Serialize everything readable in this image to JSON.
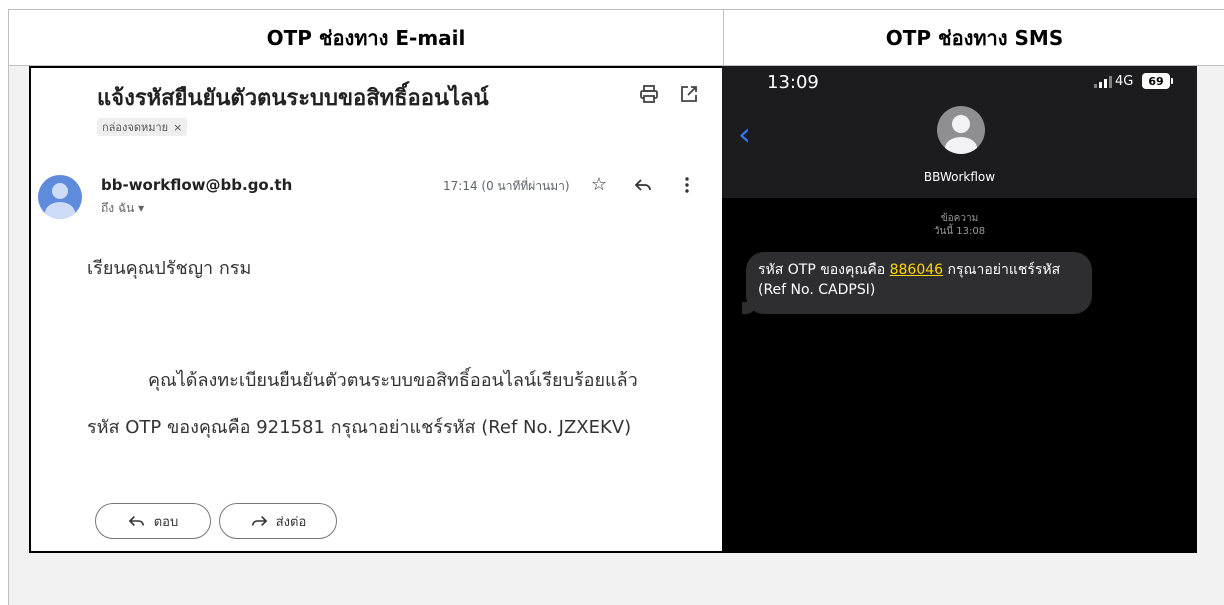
{
  "table": {
    "header_left": "OTP ช่องทาง E-mail",
    "header_right": "OTP ช่องทาง SMS"
  },
  "email": {
    "subject": "แจ้งรหัสยืนยันตัวตนระบบขอสิทธิ์ออนไลน์",
    "label": "กล่องจดหมาย",
    "label_close": "×",
    "sender": "bb-workflow@bb.go.th",
    "to": "ถึง ฉัน ▾",
    "time": "17:14 (0 นาทีที่ผ่านมา)",
    "greeting": "เรียนคุณปรัชญา กรม",
    "line1": "คุณได้ลงทะเบียนยืนยันตัวตนระบบขอสิทธิ์ออนไลน์เรียบร้อยแล้ว",
    "line2": "รหัส OTP ของคุณคือ 921581 กรุณาอย่าแชร์รหัส (Ref No. JZXEKV)",
    "reply_label": "ตอบ",
    "forward_label": "ส่งต่อ"
  },
  "sms": {
    "clock": "13:09",
    "network": "4G",
    "battery": "69",
    "contact": "BBWorkflow",
    "msg_label": "ข้อความ",
    "msg_time": "วันนี้ 13:08",
    "bubble_prefix": "รหัส OTP ของคุณคือ ",
    "code": "886046",
    "bubble_suffix": " กรุณาอย่าแชร์รหัส (Ref No. CADPSI)"
  }
}
